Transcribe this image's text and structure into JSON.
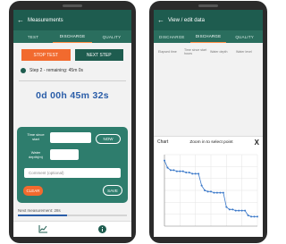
{
  "left": {
    "title": "Measurements",
    "tabs": [
      {
        "label": "TEST",
        "active": false
      },
      {
        "label": "DISCHARGE",
        "active": true
      },
      {
        "label": "QUALITY",
        "active": false
      }
    ],
    "stop_test_label": "STOP TEST",
    "next_step_label": "NEXT STEP",
    "step_text": "Step 2 - remaining: 45m 0s",
    "timer": "0d 00h 45m 32s",
    "form": {
      "time_label": "Time since start",
      "water_label": "Water depth(m)",
      "now_label": "NOW",
      "comment_placeholder": "Comment (optional)",
      "clear_label": "CLEAR",
      "save_label": "SAVE"
    },
    "next_measurement": "Next measurement: 28s",
    "progress_fraction": 0.45,
    "nav_icons": [
      "chart-icon",
      "info-icon"
    ]
  },
  "right": {
    "title": "View / edit data",
    "tabs": [
      {
        "label": "DISCHARGE",
        "active": false
      },
      {
        "label": "DISCHARGE",
        "active": true
      },
      {
        "label": "QUALITY",
        "active": false
      }
    ],
    "table_headers": [
      "Elapsed time",
      "Time since start hours",
      "Water depth",
      "Water level"
    ],
    "table_rows": [
      [
        "",
        "",
        "",
        ""
      ],
      [
        "",
        "",
        "",
        ""
      ],
      [
        "",
        "",
        "",
        ""
      ],
      [
        "",
        "",
        "",
        ""
      ],
      [
        "",
        "",
        "",
        ""
      ],
      [
        "",
        "",
        "",
        ""
      ]
    ],
    "chart_panel_title": "Chart",
    "chart_hint": "Zoom in to select point",
    "close_symbol": "X"
  },
  "chart_data": {
    "type": "line",
    "title": "",
    "xlabel": "",
    "ylabel": "",
    "x": [
      0,
      1,
      2,
      3,
      4,
      5,
      6,
      7,
      8,
      9,
      10,
      11,
      12,
      13,
      14,
      15,
      16,
      17,
      18,
      19,
      20,
      21,
      22,
      23,
      24,
      25,
      26,
      27,
      28,
      29,
      30
    ],
    "series": [
      {
        "name": "",
        "values": [
          8.5,
          7.9,
          7.7,
          7.7,
          7.6,
          7.6,
          7.6,
          7.5,
          7.5,
          7.4,
          7.4,
          7.4,
          6.4,
          6.0,
          5.9,
          5.9,
          5.8,
          5.8,
          5.8,
          5.8,
          4.6,
          4.4,
          4.4,
          4.3,
          4.3,
          4.3,
          4.3,
          3.9,
          3.8,
          3.8,
          3.8
        ]
      }
    ],
    "color": "#3a78c9",
    "grid": true
  }
}
